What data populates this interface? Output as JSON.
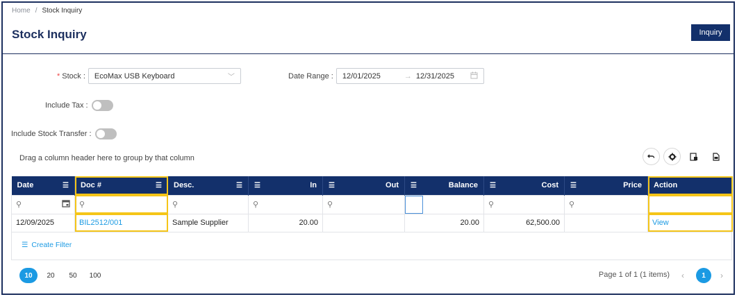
{
  "breadcrumb": {
    "home": "Home",
    "separator": "/",
    "current": "Stock Inquiry"
  },
  "page": {
    "title": "Stock Inquiry",
    "inquiry_button": "Inquiry"
  },
  "form": {
    "stock_label": "Stock :",
    "stock_required_mark": "*",
    "stock_value": "EcoMax USB Keyboard",
    "date_range_label": "Date Range :",
    "date_from": "12/01/2025",
    "date_to": "12/31/2025",
    "include_tax_label": "Include Tax :",
    "include_tax": false,
    "include_stock_transfer_label": "Include Stock Transfer :",
    "include_stock_transfer": false
  },
  "grid": {
    "group_hint": "Drag a column header here to group by that column",
    "columns": [
      "Date",
      "Doc #",
      "Desc.",
      "In",
      "Out",
      "Balance",
      "Cost",
      "Price",
      "Action"
    ],
    "rows": [
      {
        "date": "12/09/2025",
        "doc": "BIL2512/001",
        "desc": "Sample Supplier",
        "in": "20.00",
        "out": "",
        "balance": "20.00",
        "cost": "62,500.00",
        "price": "",
        "action": "View"
      }
    ],
    "create_filter": "Create Filter"
  },
  "pager": {
    "sizes": [
      "10",
      "20",
      "50",
      "100"
    ],
    "active_size": "10",
    "info": "Page 1 of 1 (1 items)",
    "current_page": "1"
  },
  "colors": {
    "navy": "#13306b",
    "accent": "#1b9ae3",
    "highlight": "#f5c518"
  }
}
